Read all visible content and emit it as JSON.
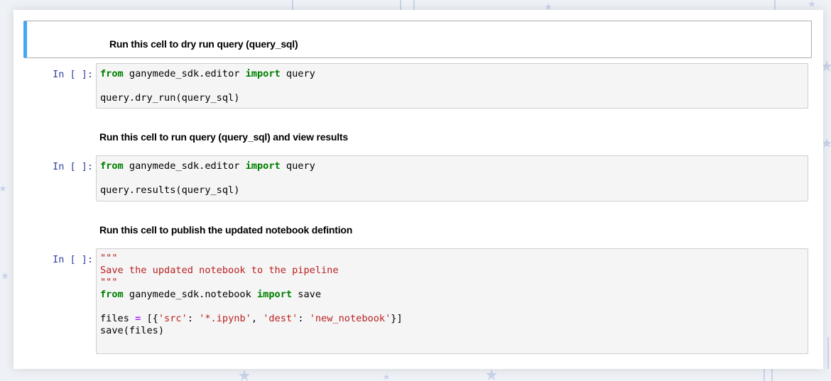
{
  "cells": {
    "md1": {
      "text": "Run this cell to dry run query (query_sql)"
    },
    "code1": {
      "prompt": "In [ ]:",
      "line1": {
        "kw1": "from",
        "mod": " ganymede_sdk.editor ",
        "kw2": "import",
        "name": " query"
      },
      "line3": "query.dry_run(query_sql)"
    },
    "md2": {
      "text": "Run this cell to run query (query_sql) and view results"
    },
    "code2": {
      "prompt": "In [ ]:",
      "line1": {
        "kw1": "from",
        "mod": " ganymede_sdk.editor ",
        "kw2": "import",
        "name": " query"
      },
      "line3": "query.results(query_sql)"
    },
    "md3": {
      "text": "Run this cell to publish the updated notebook defintion"
    },
    "code3": {
      "prompt": "In [ ]:",
      "doc_open": "\"\"\"",
      "doc_text": "Save the updated notebook to the pipeline",
      "doc_close": "\"\"\"",
      "import_line": {
        "kw1": "from",
        "mod": " ganymede_sdk.notebook ",
        "kw2": "import",
        "name": " save"
      },
      "files_line": {
        "var": "files ",
        "eq": "=",
        "open": " [{",
        "k1": "'src'",
        "c1": ": ",
        "v1": "'*.ipynb'",
        "sep": ", ",
        "k2": "'dest'",
        "c2": ": ",
        "v2": "'new_notebook'",
        "close": "}]"
      },
      "call_line": "save(files)"
    }
  },
  "colors": {
    "keyword": "#008000",
    "string": "#ba2121",
    "operator": "#aa22ff",
    "prompt": "#303f9f",
    "selected_border": "#42a5f5"
  }
}
